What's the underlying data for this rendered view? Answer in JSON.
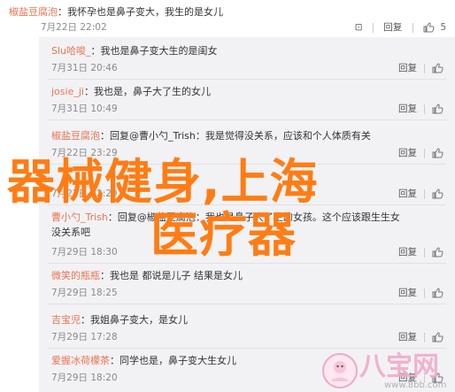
{
  "main_comment": {
    "user": "椒盐豆腐泡",
    "text": "：我怀孕也是鼻子变大，我生的是女儿",
    "time": "7月22日 22:02",
    "like_count": "5"
  },
  "replies": [
    {
      "user": "Slu哈唆_",
      "text": "：我也是鼻子变大生的是闺女",
      "time": "7月31日 20:46"
    },
    {
      "user": "josie_ji",
      "text": "：我也是，鼻子大了生的女儿",
      "time": "7月31日 10:49"
    },
    {
      "user": "椒盐豆腐泡",
      "text": "：回复@曹小勺_Trish：我是觉得没关系，应该和个人体质有关",
      "time": "7月22日 23:29"
    },
    {
      "user": "",
      "text": "",
      "time": "7月22日 22:29"
    },
    {
      "user": "曹小勺_Trish",
      "text": "：回复@椒盐豆腐泡：我也是鼻子大了生的女孩。这个应该跟生生女",
      "text2": "没关系吧",
      "time": "7月29日 18:30"
    },
    {
      "user": "微笑的瓶瓶",
      "text": "：我也是 都说是儿子 结果是女儿",
      "time": "7月29日 18:25"
    },
    {
      "user": "吉宝児",
      "text": "：我姐鼻子变大，是女儿",
      "time": "7月29日 17:28"
    },
    {
      "user": "爱握冰荷檬茶",
      "text": "：同学也是，鼻子变大生女儿",
      "time": "7月29日 18:20"
    }
  ],
  "actions": {
    "reply_label": "回复",
    "hidden_label": "回复"
  },
  "overlay": {
    "line1": "器械健身,上海",
    "line2": "医疗器"
  },
  "watermark": {
    "brand": "八宝网",
    "url": "www.8bb.com"
  }
}
